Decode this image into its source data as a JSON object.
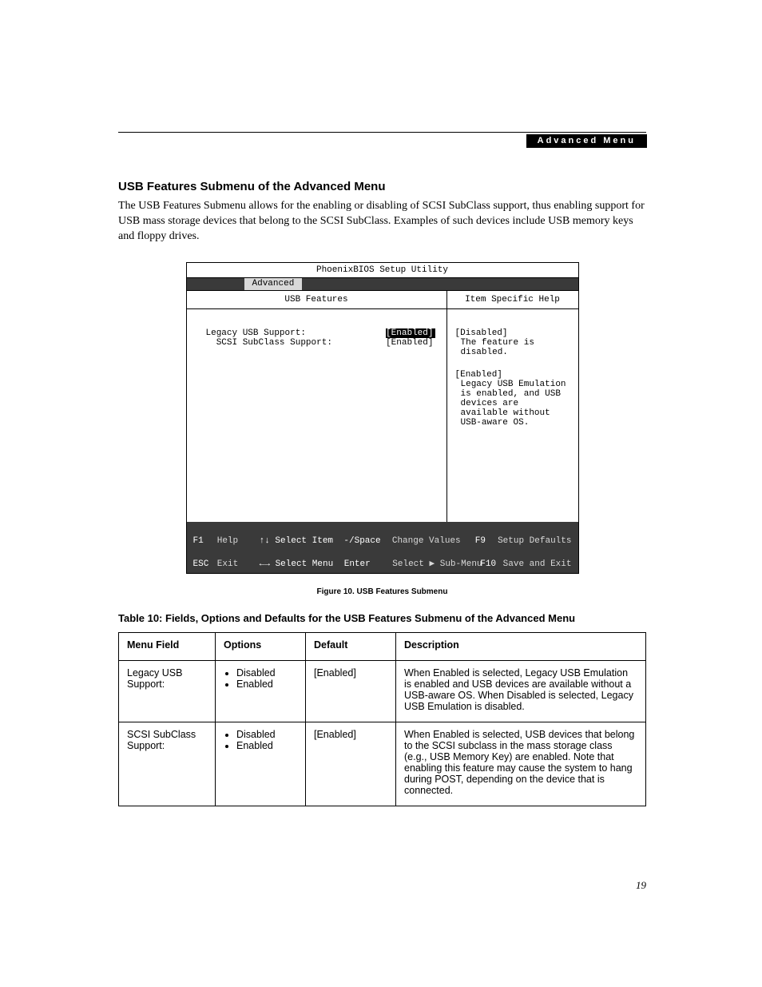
{
  "header": {
    "section": "Advanced Menu"
  },
  "title": "USB Features Submenu of the Advanced Menu",
  "paragraph": "The USB Features Submenu allows for the enabling or disabling of SCSI SubClass support, thus enabling support for USB mass storage devices that belong to the SCSI SubClass. Examples of such devices include USB memory keys and floppy drives.",
  "bios": {
    "title": "PhoenixBIOS Setup Utility",
    "active_tab": "Advanced",
    "left_header": "USB Features",
    "right_header": "Item Specific Help",
    "settings": [
      {
        "label": "Legacy USB Support:",
        "value": "[Enabled]",
        "highlighted": true
      },
      {
        "label": "  SCSI SubClass Support:",
        "value": "[Enabled]",
        "highlighted": false
      }
    ],
    "help": [
      {
        "head": "[Disabled]",
        "body": "The feature is disabled."
      },
      {
        "head": "[Enabled]",
        "body": "Legacy USB Emulation is enabled, and USB devices are available without USB-aware OS."
      }
    ],
    "footer": {
      "r1": {
        "k1": "F1",
        "a1": "Help",
        "nav": "↑↓ Select Item",
        "chgk": "-/Space",
        "chglbl": "Change Values",
        "rk": "F9",
        "rlbl": "Setup Defaults"
      },
      "r2": {
        "k1": "ESC",
        "a1": "Exit",
        "nav": "←→ Select Menu",
        "chgk": "Enter",
        "chglbl": "Select ▶ Sub-Menu",
        "rk": "F10",
        "rlbl": "Save and Exit"
      }
    }
  },
  "figure_caption": "Figure 10.  USB Features Submenu",
  "table_caption": "Table 10: Fields, Options and Defaults for the USB Features Submenu of the Advanced Menu",
  "table": {
    "headers": {
      "field": "Menu Field",
      "options": "Options",
      "default": "Default",
      "desc": "Description"
    },
    "rows": [
      {
        "field": "Legacy USB Support:",
        "options": [
          "Disabled",
          "Enabled"
        ],
        "default": "[Enabled]",
        "desc": "When Enabled is selected, Legacy USB Emulation is enabled and USB devices are available without a USB-aware OS. When Disabled is selected, Legacy USB Emulation is disabled."
      },
      {
        "field": "SCSI SubClass Support:",
        "options": [
          "Disabled",
          "Enabled"
        ],
        "default": "[Enabled]",
        "desc": "When Enabled is selected, USB devices that belong to the SCSI subclass in the mass storage class (e.g., USB Memory Key) are enabled. Note that enabling this feature may cause the system to hang during POST, depending on the device that is connected."
      }
    ]
  },
  "page_number": "19"
}
